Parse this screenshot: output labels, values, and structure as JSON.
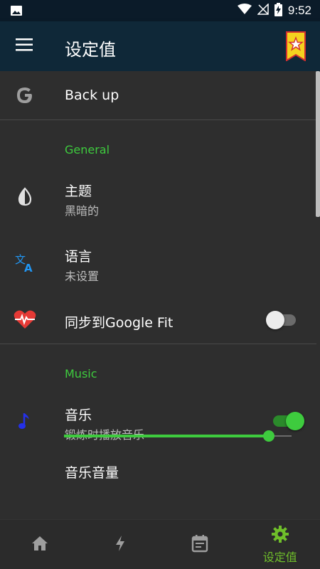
{
  "status_bar": {
    "time": "9:52",
    "icons": [
      "image-icon",
      "wifi-icon",
      "no-signal-icon",
      "battery-charging-icon"
    ]
  },
  "app_bar": {
    "title": "设定值",
    "menu_icon": "menu-icon",
    "badge_icon": "star-badge-icon"
  },
  "backup": {
    "label": "Back up",
    "icon": "google-icon"
  },
  "sections": {
    "general": "General",
    "music": "Music"
  },
  "settings": {
    "theme": {
      "title": "主题",
      "value": "黑暗的",
      "icon": "theme-drop-icon"
    },
    "language": {
      "title": "语言",
      "value": "未设置",
      "icon": "translate-icon"
    },
    "google_fit": {
      "title": "同步到Google Fit",
      "icon": "heart-pulse-icon",
      "enabled": false
    },
    "music": {
      "title": "音乐",
      "value": "锻炼时播放音乐",
      "icon": "music-note-icon",
      "enabled": true
    },
    "music_volume": {
      "title": "音乐音量",
      "level": 0.9
    }
  },
  "bottom_nav": {
    "items": [
      {
        "icon": "home-icon",
        "label": ""
      },
      {
        "icon": "lightning-icon",
        "label": ""
      },
      {
        "icon": "calendar-icon",
        "label": ""
      },
      {
        "icon": "gear-icon",
        "label": "设定值",
        "active": true
      }
    ]
  },
  "colors": {
    "accent": "#3ecb3e",
    "app_bar": "#0f2838",
    "status_bar": "#0b1b29",
    "background": "#2e2e2e",
    "nav_active": "#6fbf2a",
    "nav_inactive": "#9e9e9e"
  }
}
